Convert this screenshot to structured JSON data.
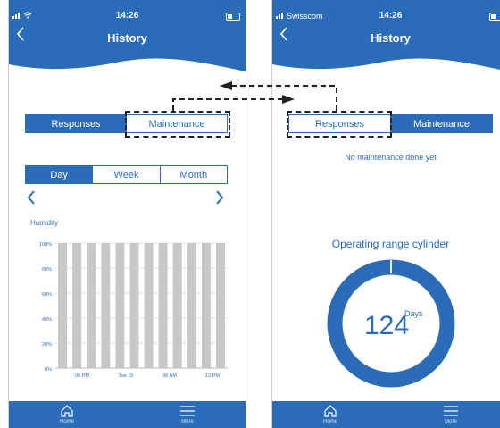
{
  "left_screen": {
    "status": {
      "time": "14:26"
    },
    "header": {
      "title": "History",
      "back_icon": "chevron-left-icon"
    },
    "segment": {
      "options": [
        "Responses",
        "Maintenance"
      ],
      "selected": "Maintenance"
    },
    "range_tabs": {
      "options": [
        "Day",
        "Week",
        "Month"
      ],
      "selected": "Day"
    },
    "chart_data": {
      "type": "bar",
      "ylabel": "Humidity",
      "ylim": [
        0,
        100
      ],
      "yticks": [
        "100%",
        "80%",
        "60%",
        "40%",
        "20%",
        "0%"
      ],
      "xticks": [
        "06 PM",
        "Tue 16",
        "06 AM",
        "12 PM"
      ],
      "values": [
        100,
        100,
        100,
        100,
        100,
        100,
        100,
        100,
        100,
        100,
        100,
        100
      ],
      "bar_color": "#c8c8c8",
      "grid": true
    },
    "tabbar": {
      "home": "Home",
      "more": "More"
    }
  },
  "right_screen": {
    "status": {
      "carrier": "Swisscom",
      "time": "14:26"
    },
    "header": {
      "title": "History",
      "back_icon": "chevron-left-icon"
    },
    "segment": {
      "options": [
        "Responses",
        "Maintenance"
      ],
      "selected": "Maintenance"
    },
    "message": "No maintenance done yet",
    "gauge": {
      "title": "Operating range cylinder",
      "value": "124",
      "unit": "Days",
      "fill_fraction": 0.99
    },
    "tabbar": {
      "home": "Home",
      "more": "More"
    }
  },
  "colors": {
    "primary": "#2b6cb8",
    "bar": "#c8c8c8",
    "background": "#ffffff"
  }
}
